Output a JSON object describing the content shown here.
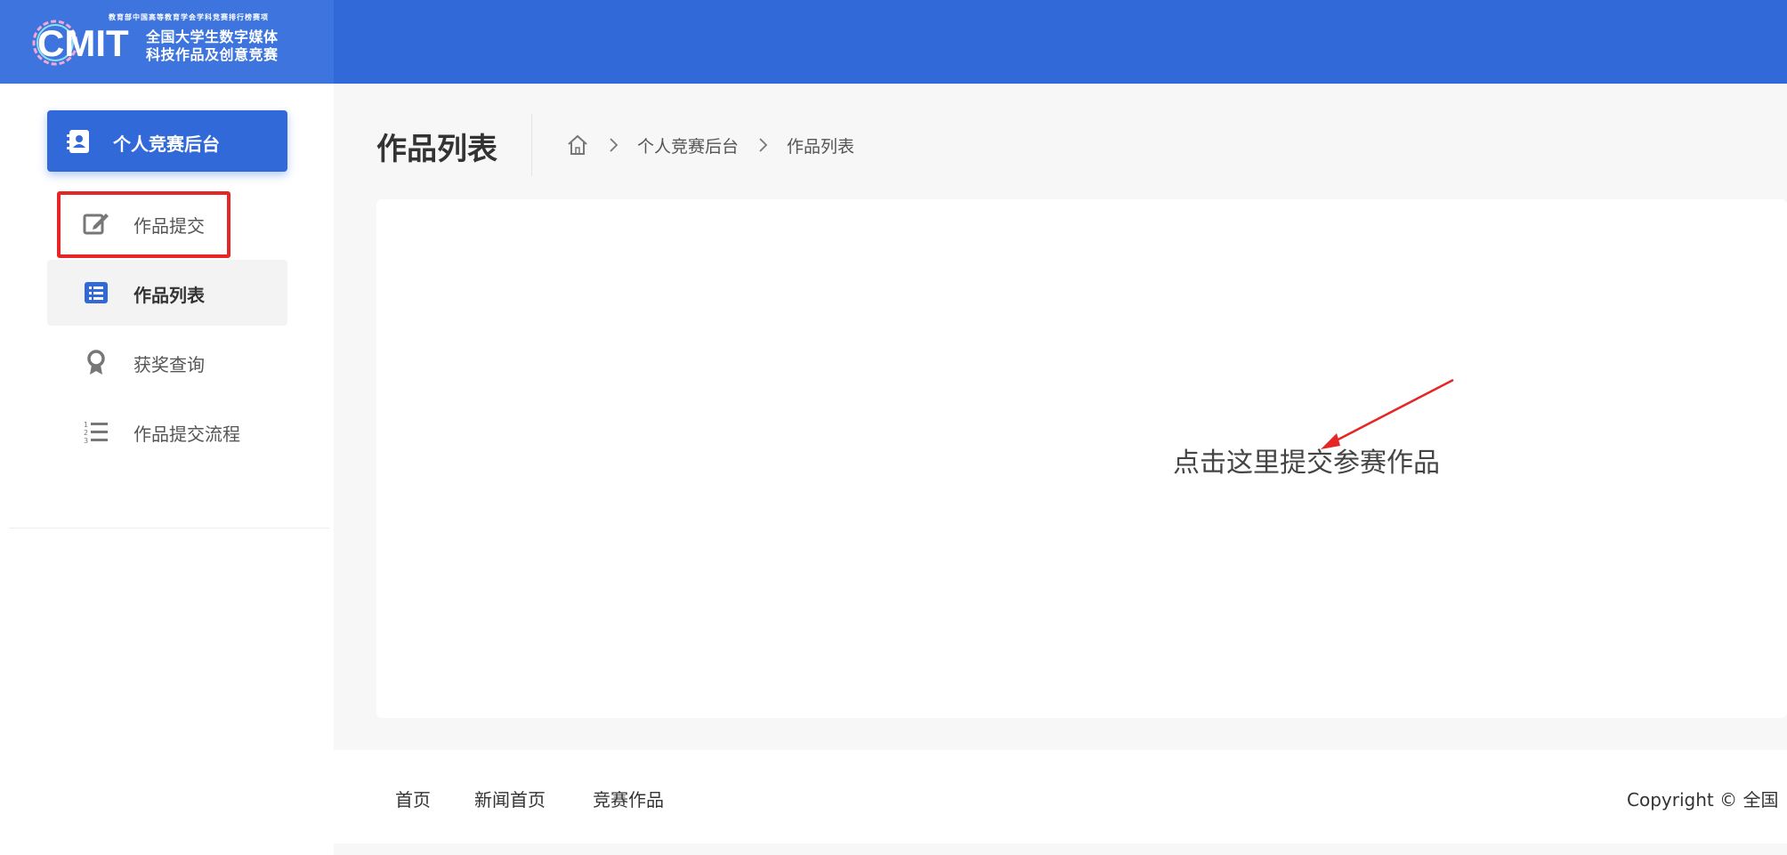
{
  "header": {
    "logo": {
      "tagline": "教育部中国高等教育学会学科竞赛排行榜赛项",
      "mark": "CMIT",
      "line1": "全国大学生数字媒体",
      "line2": "科技作品及创意竞赛"
    },
    "background_color": "#3269d9"
  },
  "sidebar": {
    "header_label": "个人竞赛后台",
    "header_icon": "contact-book-icon",
    "items": [
      {
        "label": "作品提交",
        "icon": "edit-icon",
        "highlighted": true
      },
      {
        "label": "作品列表",
        "icon": "list-icon",
        "active": true
      },
      {
        "label": "获奖查询",
        "icon": "award-icon"
      },
      {
        "label": "作品提交流程",
        "icon": "numbered-list-icon"
      }
    ]
  },
  "main": {
    "page_title": "作品列表",
    "breadcrumb": {
      "home_icon": "home-icon",
      "items": [
        "个人竞赛后台",
        "作品列表"
      ]
    },
    "hint": "点击这里提交参赛作品",
    "annotation_color": "#e62626"
  },
  "footer": {
    "links": [
      "首页",
      "新闻首页",
      "竞赛作品"
    ],
    "copyright": "Copyright © 全国"
  },
  "colors": {
    "accent": "#3269d9",
    "annotation": "#e62626"
  }
}
